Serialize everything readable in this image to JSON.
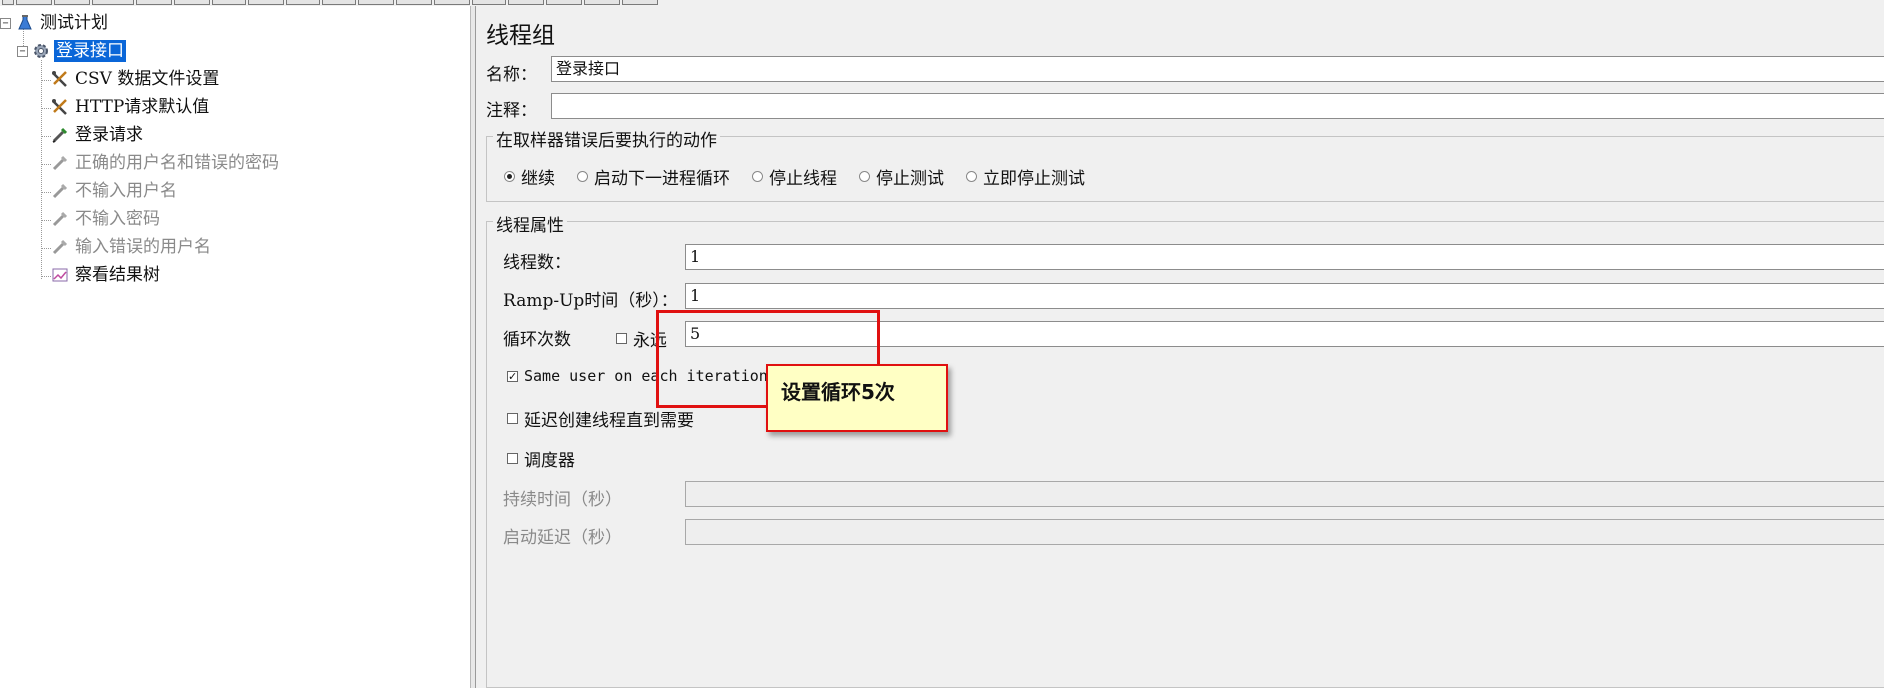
{
  "tree": {
    "items": [
      {
        "label": "测试计划",
        "icon": "flask-icon"
      },
      {
        "label": "登录接口",
        "icon": "gear-icon",
        "selected": true
      },
      {
        "label": "CSV 数据文件设置",
        "icon": "tools-icon"
      },
      {
        "label": "HTTP请求默认值",
        "icon": "tools-icon"
      },
      {
        "label": "登录请求",
        "icon": "pipette-icon"
      },
      {
        "label": "正确的用户名和错误的密码",
        "icon": "pipette-icon",
        "disabled": true
      },
      {
        "label": "不输入用户名",
        "icon": "pipette-icon",
        "disabled": true
      },
      {
        "label": "不输入密码",
        "icon": "pipette-icon",
        "disabled": true
      },
      {
        "label": "输入错误的用户名",
        "icon": "pipette-icon",
        "disabled": true
      },
      {
        "label": "察看结果树",
        "icon": "chart-icon"
      }
    ]
  },
  "panel": {
    "title": "线程组",
    "name_label": "名称：",
    "name_value": "登录接口",
    "comment_label": "注释：",
    "comment_value": "",
    "error_group": {
      "title": "在取样器错误后要执行的动作",
      "options": [
        "继续",
        "启动下一进程循环",
        "停止线程",
        "停止测试",
        "立即停止测试"
      ],
      "selected": "继续"
    },
    "thread_group": {
      "title": "线程属性",
      "threads_label": "线程数：",
      "threads_value": "1",
      "rampup_label": "Ramp-Up时间（秒）：",
      "rampup_value": "1",
      "loop_label": "循环次数",
      "forever_label": "永远",
      "forever_checked": false,
      "loop_value": "5",
      "same_user_label": "Same user on each iteration",
      "same_user_checked": true,
      "delay_label": "延迟创建线程直到需要",
      "delay_checked": false,
      "scheduler_label": "调度器",
      "scheduler_checked": false,
      "duration_label": "持续时间（秒）",
      "duration_value": "",
      "startup_delay_label": "启动延迟（秒）",
      "startup_delay_value": ""
    }
  },
  "annotation": {
    "text": "设置循环5次",
    "color": "#e01010",
    "background": "#ffffc4"
  },
  "colors": {
    "selection": "#0a66d8",
    "panel_bg": "#f0f0f0"
  }
}
